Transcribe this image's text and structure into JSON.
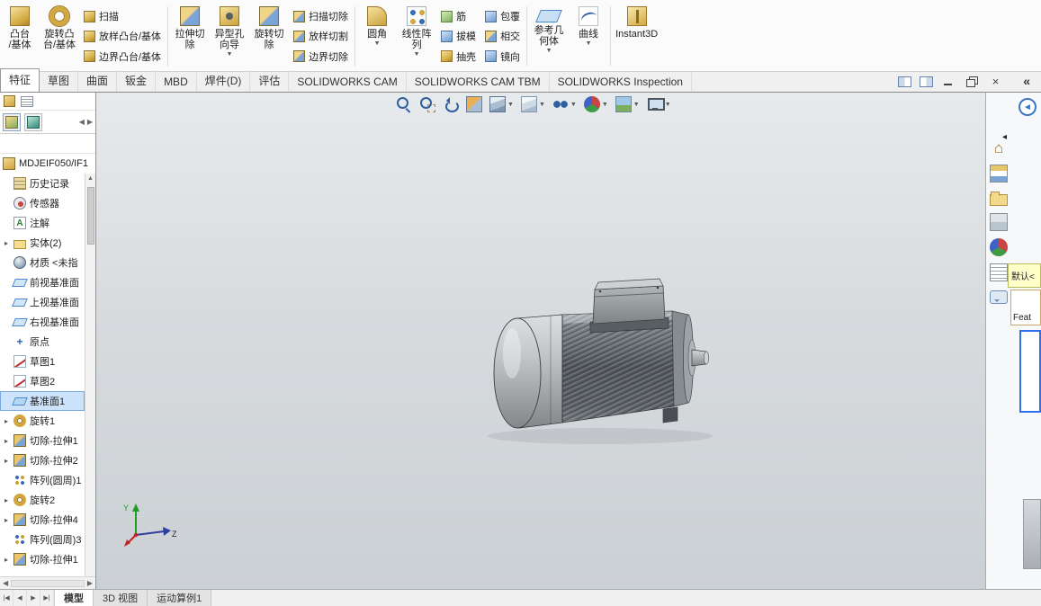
{
  "glyphs": {
    "collapse": "«",
    "back": "◄",
    "small_left": "◂",
    "left": "◀",
    "right": "▶",
    "up": "▲",
    "down": "▼",
    "caret": "▼",
    "expand": "▸",
    "close": "×",
    "home": "⌂"
  },
  "ribbon": {
    "boss_base": "凸台\n/基体",
    "revolve_boss": "旋转凸\n台/基体",
    "sweep": "扫描",
    "loft": "放样凸台/基体",
    "boundary": "边界凸台/基体",
    "extruded_cut": "拉伸切\n除",
    "hole_wizard": "异型孔\n向导",
    "revolved_cut": "旋转切\n除",
    "swept_cut": "扫描切除",
    "lofted_cut": "放样切割",
    "boundary_cut": "边界切除",
    "fillet": "圆角",
    "linear_pattern": "线性阵\n列",
    "rib": "筋",
    "draft": "拔模",
    "shell": "抽壳",
    "wrap": "包覆",
    "intersect": "相交",
    "mirror": "镜向",
    "ref_geometry": "参考几\n何体",
    "curves": "曲线",
    "instant3d": "Instant3D"
  },
  "tabs": [
    {
      "label": "特征",
      "active": true
    },
    {
      "label": "草图"
    },
    {
      "label": "曲面"
    },
    {
      "label": "钣金"
    },
    {
      "label": "MBD"
    },
    {
      "label": "焊件(D)"
    },
    {
      "label": "评估"
    },
    {
      "label": "SOLIDWORKS CAM"
    },
    {
      "label": "SOLIDWORKS CAM TBM"
    },
    {
      "label": "SOLIDWORKS Inspection"
    }
  ],
  "tree": {
    "root": "MDJEIF050/IF1",
    "items": [
      {
        "label": "历史记录",
        "icon": "history"
      },
      {
        "label": "传感器",
        "icon": "sensors"
      },
      {
        "label": "注解",
        "icon": "annot"
      },
      {
        "label": "实体(2)",
        "icon": "solids",
        "expand": true
      },
      {
        "label": "材质 <未指",
        "icon": "material"
      },
      {
        "label": "前视基准面",
        "icon": "plane"
      },
      {
        "label": "上视基准面",
        "icon": "plane"
      },
      {
        "label": "右视基准面",
        "icon": "plane"
      },
      {
        "label": "原点",
        "icon": "origin"
      },
      {
        "label": "草图1",
        "icon": "sketch"
      },
      {
        "label": "草图2",
        "icon": "sketch"
      },
      {
        "label": "基准面1",
        "icon": "plane",
        "selected": true
      },
      {
        "label": "旋转1",
        "icon": "revolve",
        "expand": true
      },
      {
        "label": "切除-拉伸1",
        "icon": "cut",
        "expand": true
      },
      {
        "label": "切除-拉伸2",
        "icon": "cut",
        "expand": true
      },
      {
        "label": "阵列(圆周)1",
        "icon": "pattern"
      },
      {
        "label": "旋转2",
        "icon": "revolve",
        "expand": true
      },
      {
        "label": "切除-拉伸4",
        "icon": "cut",
        "expand": true
      },
      {
        "label": "阵列(圆周)3",
        "icon": "pattern"
      },
      {
        "label": "切除-拉伸1",
        "icon": "cut",
        "expand": true
      }
    ]
  },
  "status": {
    "nav": [
      "|◀",
      "◀",
      "▶",
      "▶|"
    ],
    "tabs": [
      {
        "label": "模型",
        "active": true
      },
      {
        "label": "3D 视图"
      },
      {
        "label": "运动算例1"
      }
    ]
  },
  "flyout": {
    "config": "默认<",
    "feat": "Feat"
  },
  "triad": {
    "y": "Y",
    "z": "Z"
  }
}
